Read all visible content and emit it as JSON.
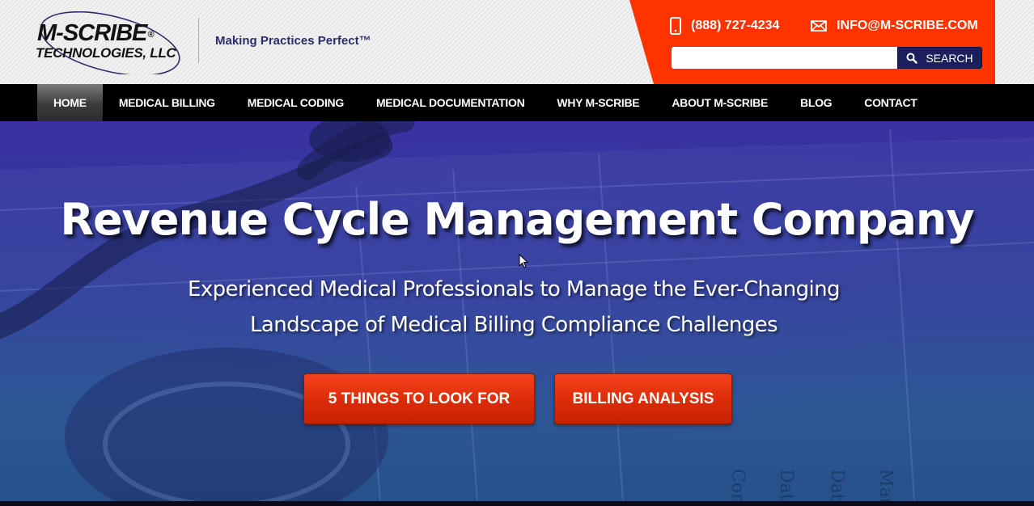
{
  "header": {
    "logo": {
      "line1": "M-SCRIBE",
      "reg": "®",
      "line2": "TECHNOLOGIES, LLC"
    },
    "tagline": "Making Practices Perfect™",
    "phone": "(888) 727-4234",
    "email": "INFO@M-SCRIBE.COM",
    "search": {
      "placeholder": "",
      "value": "",
      "button_label": "SEARCH"
    },
    "accent_color": "#ff3300",
    "brand_color": "#2b2d6b"
  },
  "nav": {
    "items": [
      {
        "label": "HOME",
        "active": true
      },
      {
        "label": "MEDICAL BILLING"
      },
      {
        "label": "MEDICAL CODING"
      },
      {
        "label": "MEDICAL DOCUMENTATION"
      },
      {
        "label": "WHY M-SCRIBE"
      },
      {
        "label": "ABOUT M-SCRIBE"
      },
      {
        "label": "BLOG"
      },
      {
        "label": "CONTACT"
      }
    ]
  },
  "hero": {
    "title": "Revenue Cycle Management Company",
    "subtitle_line1": "Experienced Medical Professionals to Manage the Ever-Changing",
    "subtitle_line2": "Landscape of Medical Billing Compliance Challenges",
    "buttons": [
      {
        "label": "5 THINGS TO LOOK FOR"
      },
      {
        "label": "BILLING ANALYSIS"
      }
    ],
    "button_color": "#e0320c"
  },
  "icons": {
    "phone": "mobile-phone-icon",
    "email": "envelope-icon",
    "search": "magnifier-icon",
    "cursor": "mouse-pointer-icon"
  }
}
